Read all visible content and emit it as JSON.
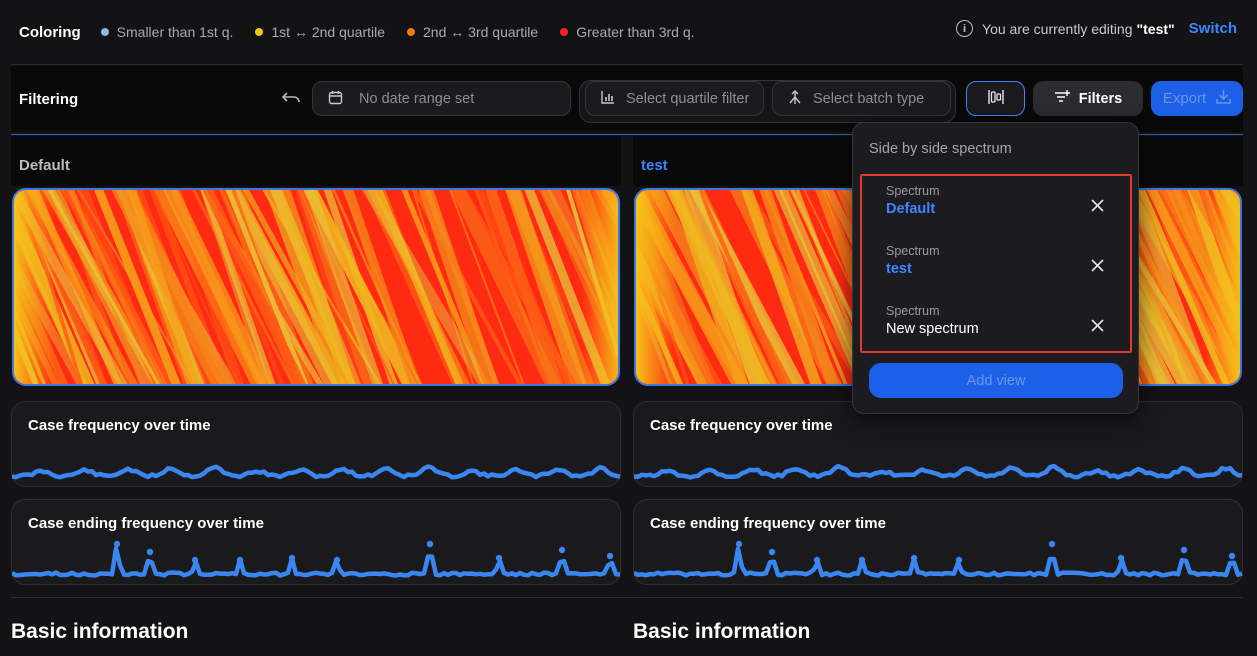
{
  "coloring": {
    "title": "Coloring",
    "legend": [
      {
        "label": "Smaller than 1st q.",
        "color": "#8fb8e8"
      },
      {
        "label": "1st ↔ 2nd quartile",
        "color": "#f2c21b"
      },
      {
        "label": "2nd ↔ 3rd quartile",
        "color": "#f07a1a"
      },
      {
        "label": "Greater than 3rd q.",
        "color": "#ff2020"
      }
    ]
  },
  "editing": {
    "prefix": "You are currently editing",
    "name": "\"test\"",
    "switch_label": "Switch",
    "info_icon": "ⓘ"
  },
  "filtering": {
    "title": "Filtering",
    "undo_icon": "↶",
    "date_placeholder": "No date range set",
    "quartile_placeholder": "Select quartile filter",
    "batch_placeholder": "Select batch type",
    "side_by_side_icon": "◫",
    "filters_label": "Filters",
    "export_label": "Export"
  },
  "columns": [
    {
      "title": "Default",
      "title_color": "#bcbcc3",
      "case_frequency_title": "Case frequency over time",
      "case_ending_title": "Case ending frequency over time",
      "basic_info": "Basic information"
    },
    {
      "title": "test",
      "title_color": "#3b86ff",
      "case_frequency_title": "Case frequency over time",
      "case_ending_title": "Case ending frequency over time",
      "basic_info": "Basic information"
    }
  ],
  "popup": {
    "title": "Side by side spectrum",
    "items": [
      {
        "kind": "Spectrum",
        "value": "Default",
        "value_color": "#3b86ff"
      },
      {
        "kind": "Spectrum",
        "value": "test",
        "value_color": "#3b86ff"
      },
      {
        "kind": "Spectrum",
        "value": "New spectrum",
        "value_color": "#ffffff"
      }
    ],
    "add_label": "Add view"
  }
}
